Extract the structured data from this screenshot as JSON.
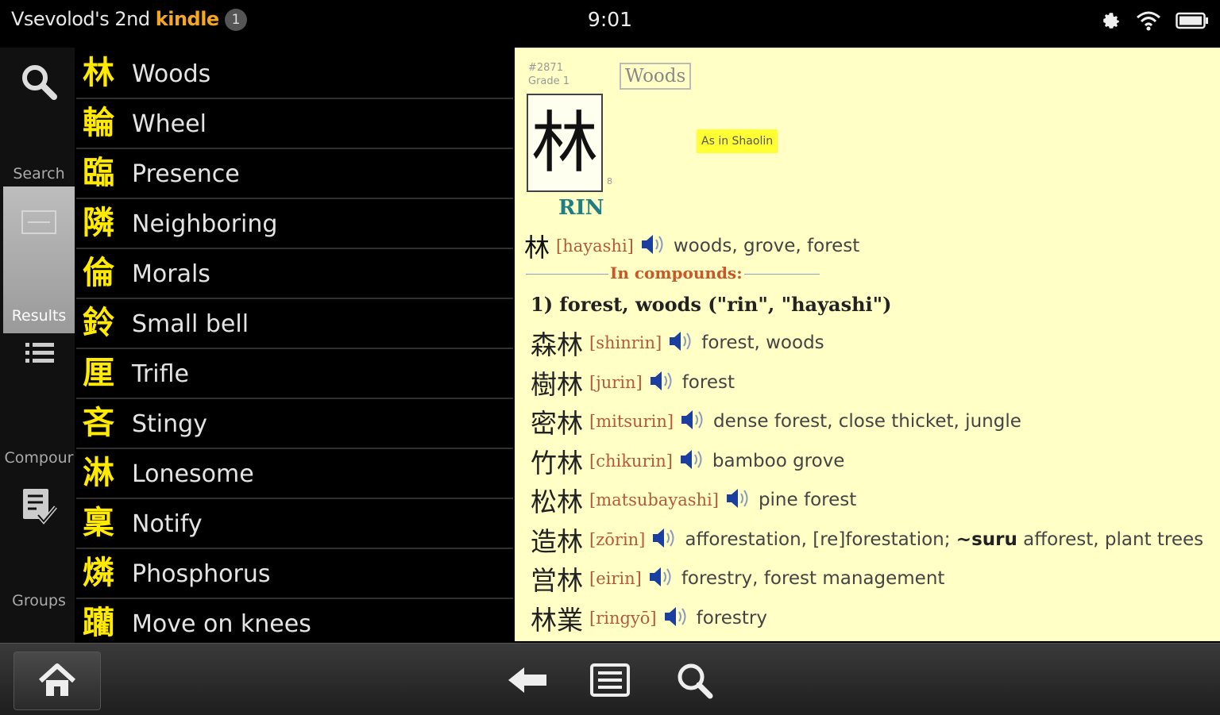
{
  "status_bar": {
    "device_name_prefix": "Vsevolod's 2nd",
    "device_name_brand": "kindle",
    "notification_count": "1",
    "time": "9:01"
  },
  "rail": {
    "search_label": "Search",
    "results_label": "Results",
    "compounds_label": "Compour",
    "groups_label": "Groups"
  },
  "results": [
    {
      "kanji": "林",
      "meaning": "Woods"
    },
    {
      "kanji": "輪",
      "meaning": "Wheel"
    },
    {
      "kanji": "臨",
      "meaning": "Presence"
    },
    {
      "kanji": "隣",
      "meaning": "Neighboring"
    },
    {
      "kanji": "倫",
      "meaning": "Morals"
    },
    {
      "kanji": "鈴",
      "meaning": "Small bell"
    },
    {
      "kanji": "厘",
      "meaning": "Trifle"
    },
    {
      "kanji": "吝",
      "meaning": "Stingy"
    },
    {
      "kanji": "淋",
      "meaning": "Lonesome"
    },
    {
      "kanji": "稟",
      "meaning": "Notify"
    },
    {
      "kanji": "燐",
      "meaning": "Phosphorus"
    },
    {
      "kanji": "躪",
      "meaning": "Move on knees"
    }
  ],
  "detail": {
    "number": "#2871",
    "grade": "Grade 1",
    "keyword": "Woods",
    "kanji": "林",
    "stroke_count": "8",
    "onyomi": "RIN",
    "mnemonic": "As in Shaolin",
    "kun": {
      "kanji": "林",
      "reading": "[hayashi]",
      "gloss": "woods, grove, forest"
    },
    "compounds_heading": "In compounds:",
    "sense": "1) forest, woods (\"rin\", \"hayashi\")",
    "compounds": [
      {
        "kanji": "森林",
        "reading": "[shinrin]",
        "gloss": "forest, woods"
      },
      {
        "kanji": "樹林",
        "reading": "[jurin]",
        "gloss": "forest"
      },
      {
        "kanji": "密林",
        "reading": "[mitsurin]",
        "gloss": "dense forest, close thicket, jungle"
      },
      {
        "kanji": "竹林",
        "reading": "[chikurin]",
        "gloss": "bamboo grove"
      },
      {
        "kanji": "松林",
        "reading": "[matsubayashi]",
        "gloss": "pine forest"
      },
      {
        "kanji": "造林",
        "reading": "[zōrin]",
        "gloss_pre": "afforestation, [re]forestation; ",
        "gloss_bold": "~suru",
        "gloss_post": " afforest, plant trees"
      },
      {
        "kanji": "営林",
        "reading": "[eirin]",
        "gloss": "forestry, forest management"
      },
      {
        "kanji": "林業",
        "reading": "[ringyō]",
        "gloss": "forestry"
      }
    ]
  },
  "colors": {
    "kanji_list": "#ffea00",
    "detail_background": "#ffffc6",
    "reading": "#b5593b",
    "onyomi": "#1e7f82",
    "heading": "#c9572a",
    "speaker": "#1a3fa0"
  }
}
